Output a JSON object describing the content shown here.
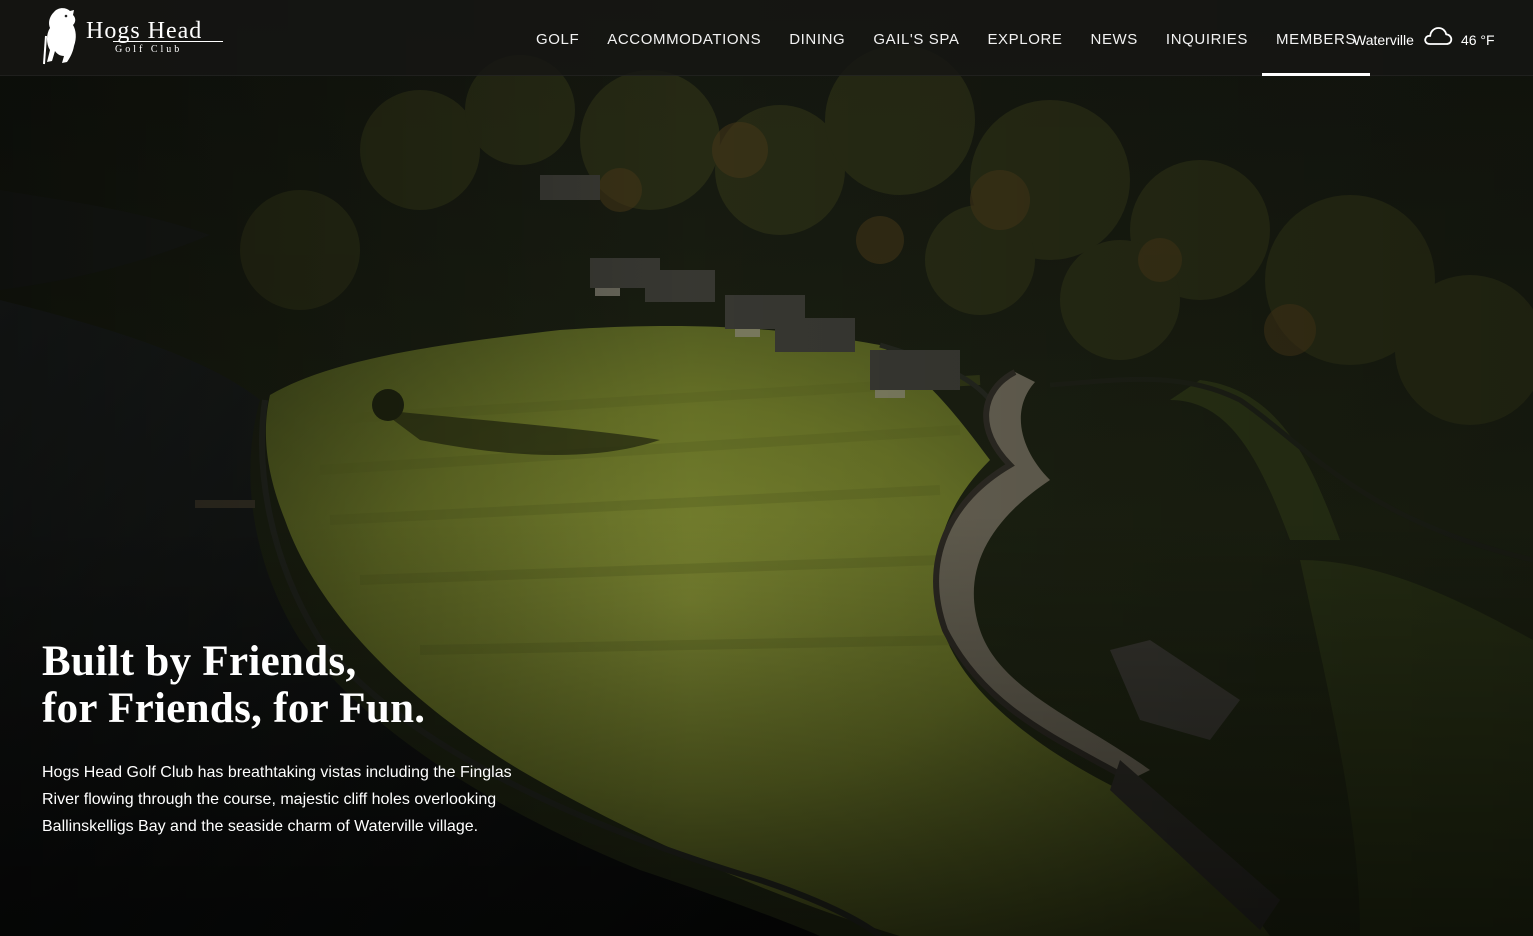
{
  "brand": {
    "name": "Hogs Head",
    "subtitle": "Golf Club"
  },
  "nav": {
    "items": [
      {
        "label": "GOLF"
      },
      {
        "label": "ACCOMMODATIONS"
      },
      {
        "label": "DINING"
      },
      {
        "label": "GAIL'S SPA"
      },
      {
        "label": "EXPLORE"
      },
      {
        "label": "NEWS"
      },
      {
        "label": "INQUIRIES"
      },
      {
        "label": "MEMBERS",
        "active": true
      }
    ]
  },
  "weather": {
    "location": "Waterville",
    "icon": "cloud-icon",
    "temperature": "46 °F"
  },
  "hero": {
    "headline_line1": "Built by Friends,",
    "headline_line2": "for Friends, for Fun.",
    "body": "Hogs Head Golf Club has breathtaking vistas including the Finglas River flowing through the course, majestic cliff holes overlooking Ballinskelligs Bay and the seaside charm of Waterville village."
  },
  "colors": {
    "nav_background": "#161614",
    "text": "#ffffff",
    "fairway": "#6f7a2e",
    "water": "#121412",
    "forest": "#1b1f11"
  }
}
